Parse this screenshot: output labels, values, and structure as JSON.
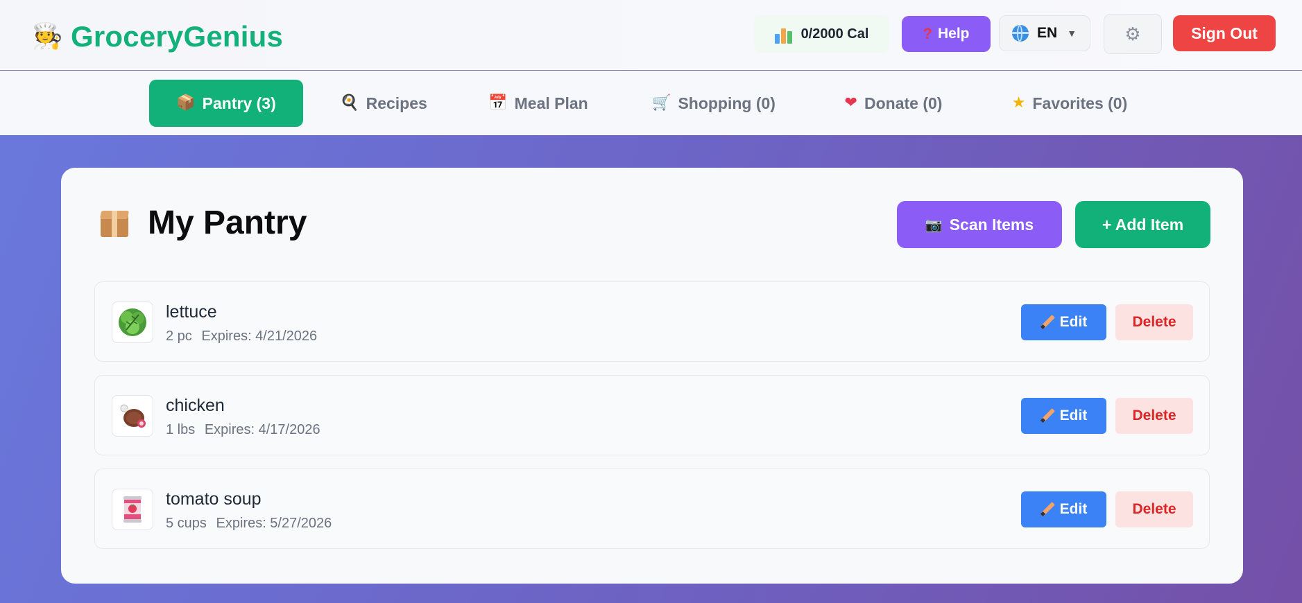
{
  "app": {
    "name": "GroceryGenius",
    "logo_icon": "chef-icon"
  },
  "header": {
    "calories": "0/2000 Cal",
    "help_label": "Help",
    "language": "EN",
    "signout_label": "Sign Out"
  },
  "tabs": [
    {
      "label": "Pantry (3)",
      "icon": "package-icon",
      "active": true
    },
    {
      "label": "Recipes",
      "icon": "search-pan-icon",
      "active": false
    },
    {
      "label": "Meal Plan",
      "icon": "calendar-icon",
      "active": false
    },
    {
      "label": "Shopping (0)",
      "icon": "cart-icon",
      "active": false
    },
    {
      "label": "Donate (0)",
      "icon": "heart-icon",
      "active": false
    },
    {
      "label": "Favorites (0)",
      "icon": "star-icon",
      "active": false
    }
  ],
  "pantry": {
    "title": "My Pantry",
    "scan_label": "Scan Items",
    "add_label": "+ Add Item",
    "items": [
      {
        "name": "lettuce",
        "quantity": "2 pc",
        "expires": "Expires: 4/21/2026",
        "icon": "lettuce-icon"
      },
      {
        "name": "chicken",
        "quantity": "1 lbs",
        "expires": "Expires: 4/17/2026",
        "icon": "meat-icon"
      },
      {
        "name": "tomato soup",
        "quantity": "5 cups",
        "expires": "Expires: 5/27/2026",
        "icon": "soup-can-icon"
      }
    ],
    "edit_label": "Edit",
    "delete_label": "Delete"
  },
  "colors": {
    "brand": "#12b17a",
    "purple": "#8b5cf6",
    "danger": "#ef4444",
    "edit": "#3b82f6"
  }
}
